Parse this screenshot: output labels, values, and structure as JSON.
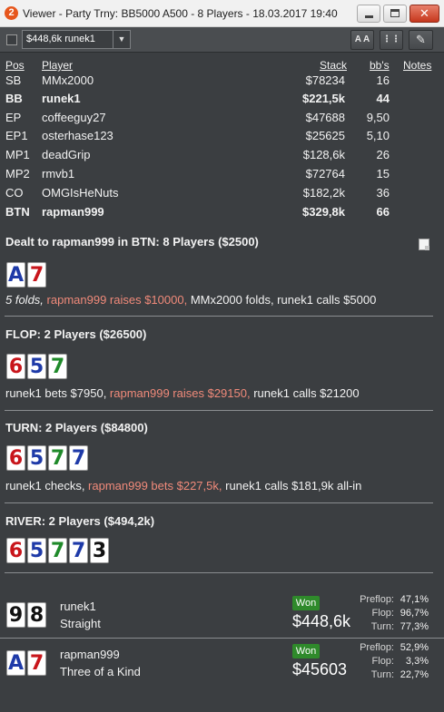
{
  "window": {
    "badge": "2",
    "title": "Viewer - Party Trny: BB5000 A500 - 8 Players - 18.03.2017 19:40",
    "minimize_glyph": "",
    "maximize_glyph": "",
    "close_glyph": "✕"
  },
  "toolbar": {
    "player_select": "$448,6k runek1",
    "font_button": "A A",
    "grid_button": "⋮⋮",
    "edit_button": "✎"
  },
  "table": {
    "headers": {
      "pos": "Pos",
      "player": "Player",
      "stack": "Stack",
      "bbs": "bb's",
      "notes": "Notes"
    },
    "rows": [
      {
        "pos": "SB",
        "player": "MMx2000",
        "stack": "$78234",
        "bbs": "16",
        "bold": false
      },
      {
        "pos": "BB",
        "player": "runek1",
        "stack": "$221,5k",
        "bbs": "44",
        "bold": true
      },
      {
        "pos": "EP",
        "player": "coffeeguy27",
        "stack": "$47688",
        "bbs": "9,50",
        "bold": false
      },
      {
        "pos": "EP1",
        "player": "osterhase123",
        "stack": "$25625",
        "bbs": "5,10",
        "bold": false
      },
      {
        "pos": "MP1",
        "player": "deadGrip",
        "stack": "$128,6k",
        "bbs": "26",
        "bold": false
      },
      {
        "pos": "MP2",
        "player": "rmvb1",
        "stack": "$72764",
        "bbs": "15",
        "bold": false
      },
      {
        "pos": "CO",
        "player": "OMGIsHeNuts",
        "stack": "$182,2k",
        "bbs": "36",
        "bold": false
      },
      {
        "pos": "BTN",
        "player": "rapman999",
        "stack": "$329,8k",
        "bbs": "66",
        "bold": true
      }
    ]
  },
  "hand": {
    "preflop": {
      "title": "Dealt to rapman999 in BTN: 8 Players ($2500)",
      "cards": [
        {
          "rank": "A",
          "color": "#1e3aa8"
        },
        {
          "rank": "7",
          "color": "#c8151b"
        }
      ],
      "action": {
        "folds": "5 folds, ",
        "hero": "rapman999 raises $10000, ",
        "rest": "MMx2000 folds, runek1 calls $5000"
      }
    },
    "flop": {
      "title": "FLOP: 2 Players ($26500)",
      "cards": [
        {
          "rank": "6",
          "color": "#c8151b"
        },
        {
          "rank": "5",
          "color": "#1e3aa8"
        },
        {
          "rank": "7",
          "color": "#1f8a2a"
        }
      ],
      "action": {
        "pre": "runek1 bets $7950, ",
        "hero": "rapman999 raises $29150, ",
        "post": "runek1 calls $21200"
      }
    },
    "turn": {
      "title": "TURN: 2 Players ($84800)",
      "cards": [
        {
          "rank": "6",
          "color": "#c8151b"
        },
        {
          "rank": "5",
          "color": "#1e3aa8"
        },
        {
          "rank": "7",
          "color": "#1f8a2a"
        },
        {
          "rank": "7",
          "color": "#1e3aa8"
        }
      ],
      "action": {
        "pre": "runek1 checks, ",
        "hero": "rapman999 bets $227,5k, ",
        "post": "runek1 calls $181,9k all-in"
      }
    },
    "river": {
      "title": "RIVER: 2 Players ($494,2k)",
      "cards": [
        {
          "rank": "6",
          "color": "#c8151b"
        },
        {
          "rank": "5",
          "color": "#1e3aa8"
        },
        {
          "rank": "7",
          "color": "#1f8a2a"
        },
        {
          "rank": "7",
          "color": "#1e3aa8"
        },
        {
          "rank": "3",
          "color": "#111111"
        }
      ]
    }
  },
  "results": [
    {
      "player": "runek1",
      "hand": "Straight",
      "won_label": "Won",
      "amount": "$448,6k",
      "cards": [
        {
          "rank": "9",
          "color": "#111111"
        },
        {
          "rank": "8",
          "color": "#111111"
        }
      ],
      "equity": [
        {
          "label": "Preflop:",
          "value": "47,1%"
        },
        {
          "label": "Flop:",
          "value": "96,7%"
        },
        {
          "label": "Turn:",
          "value": "77,3%"
        }
      ]
    },
    {
      "player": "rapman999",
      "hand": "Three of a Kind",
      "won_label": "Won",
      "amount": "$45603",
      "cards": [
        {
          "rank": "A",
          "color": "#1e3aa8"
        },
        {
          "rank": "7",
          "color": "#c8151b"
        }
      ],
      "equity": [
        {
          "label": "Preflop:",
          "value": "52,9%"
        },
        {
          "label": "Flop:",
          "value": "3,3%"
        },
        {
          "label": "Turn:",
          "value": "22,7%"
        }
      ]
    }
  ]
}
